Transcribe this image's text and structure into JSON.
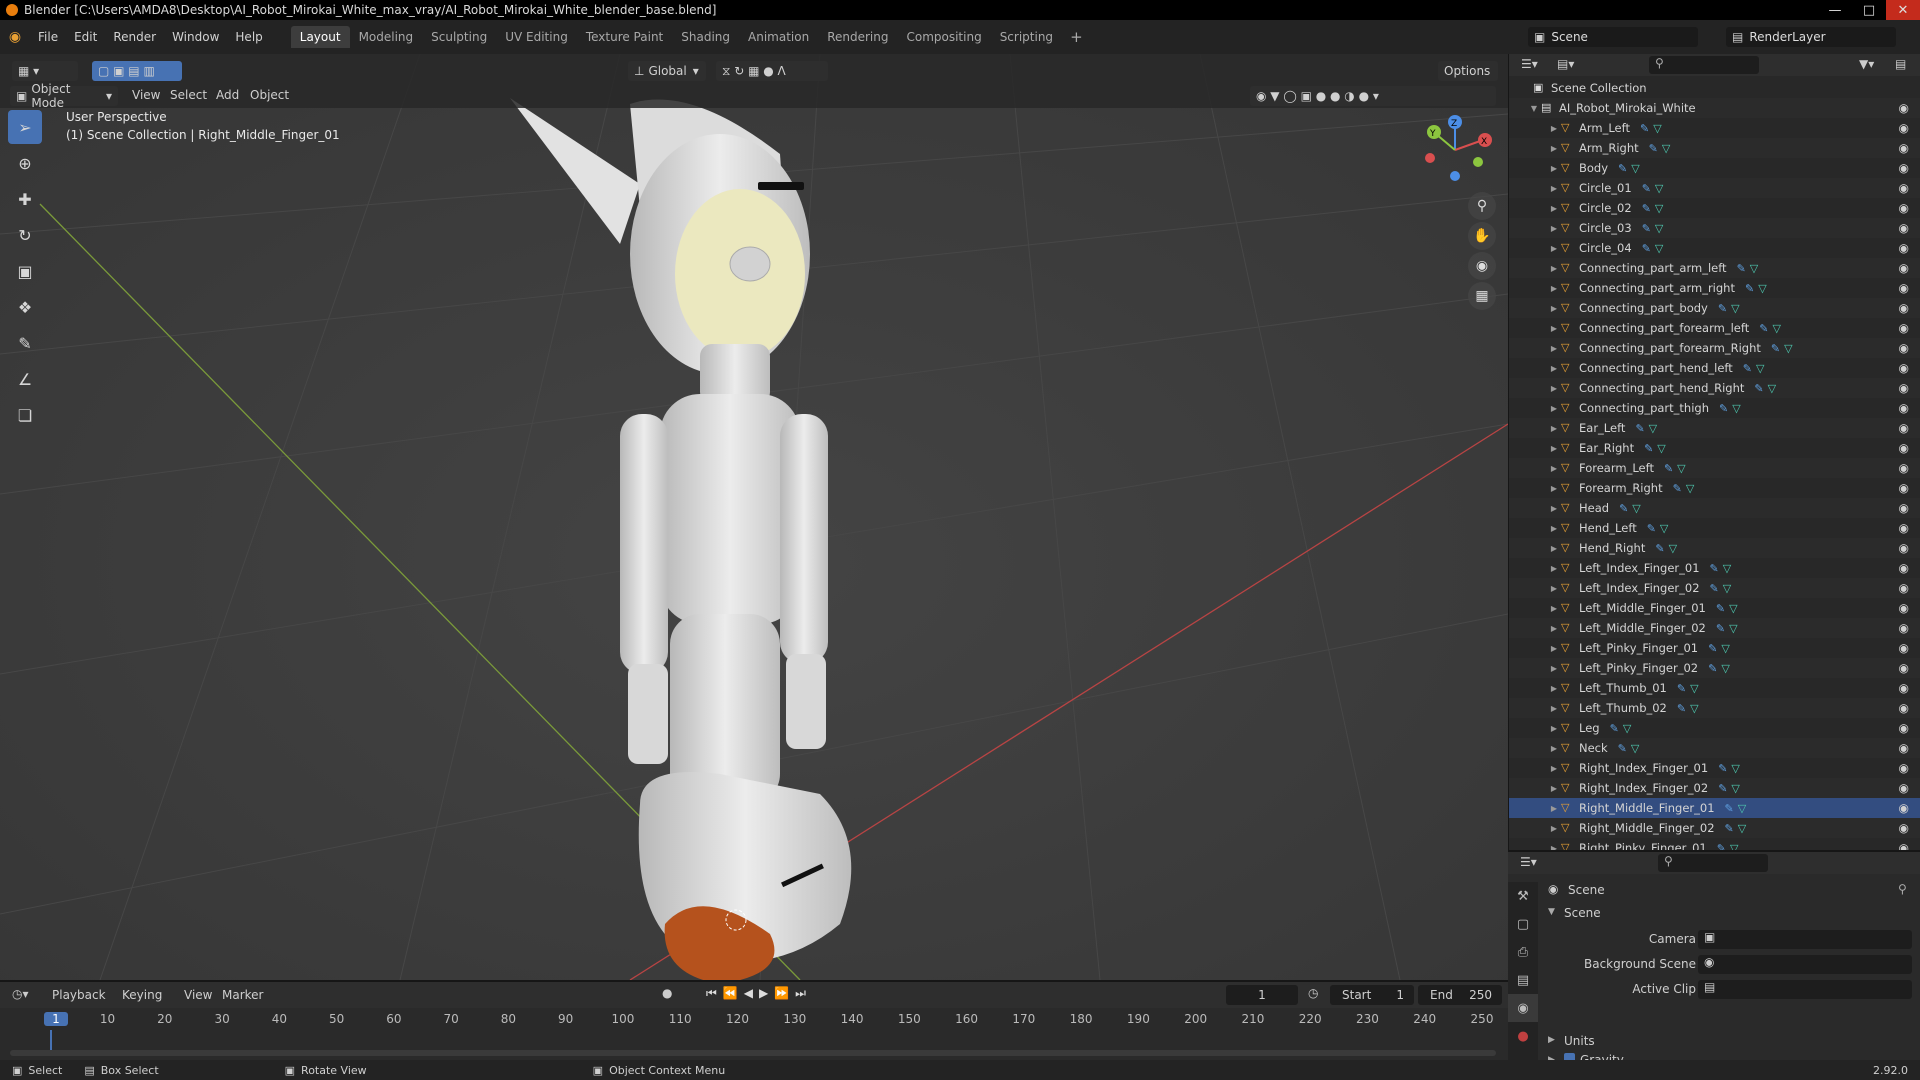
{
  "window": {
    "title": "Blender [C:\\Users\\AMDA8\\Desktop\\AI_Robot_Mirokai_White_max_vray/AI_Robot_Mirokai_White_blender_base.blend]",
    "min_icon": "minimize-icon",
    "max_icon": "maximize-icon",
    "close_icon": "close-icon"
  },
  "menus": [
    "File",
    "Edit",
    "Render",
    "Window",
    "Help"
  ],
  "workspaces": [
    "Layout",
    "Modeling",
    "Sculpting",
    "UV Editing",
    "Texture Paint",
    "Shading",
    "Animation",
    "Rendering",
    "Compositing",
    "Scripting"
  ],
  "active_workspace": "Layout",
  "scene_name": "Scene",
  "render_layer": "RenderLayer",
  "viewport": {
    "mode": "Object Mode",
    "menu": [
      "View",
      "Select",
      "Add",
      "Object"
    ],
    "orientation": "Global",
    "options": "Options",
    "perspective": "User Perspective",
    "collection_info": "(1) Scene Collection | Right_Middle_Finger_01",
    "gizmo": {
      "x": "X",
      "y": "Y",
      "z": "Z"
    }
  },
  "outliner": {
    "root": "Scene Collection",
    "collection": "AI_Robot_Mirokai_White",
    "selected": "Right_Middle_Finger_01",
    "items": [
      "Arm_Left",
      "Arm_Right",
      "Body",
      "Circle_01",
      "Circle_02",
      "Circle_03",
      "Circle_04",
      "Connecting_part_arm_left",
      "Connecting_part_arm_right",
      "Connecting_part_body",
      "Connecting_part_forearm_left",
      "Connecting_part_forearm_Right",
      "Connecting_part_hend_left",
      "Connecting_part_hend_Right",
      "Connecting_part_thigh",
      "Ear_Left",
      "Ear_Right",
      "Forearm_Left",
      "Forearm_Right",
      "Head",
      "Hend_Left",
      "Hend_Right",
      "Left_Index_Finger_01",
      "Left_Index_Finger_02",
      "Left_Middle_Finger_01",
      "Left_Middle_Finger_02",
      "Left_Pinky_Finger_01",
      "Left_Pinky_Finger_02",
      "Left_Thumb_01",
      "Left_Thumb_02",
      "Leg",
      "Neck",
      "Right_Index_Finger_01",
      "Right_Index_Finger_02",
      "Right_Middle_Finger_01",
      "Right_Middle_Finger_02",
      "Right_Pinky_Finger_01"
    ]
  },
  "properties": {
    "header": "Scene",
    "section": "Scene",
    "fields": [
      "Camera",
      "Background Scene",
      "Active Clip"
    ],
    "units": "Units",
    "gravity": "Gravity"
  },
  "timeline": {
    "menu": [
      "Playback",
      "Keying",
      "View",
      "Marker"
    ],
    "current_frame": "1",
    "start_label": "Start",
    "start": "1",
    "end_label": "End",
    "end": "250",
    "ticks": [
      "1",
      "10",
      "20",
      "30",
      "40",
      "50",
      "60",
      "70",
      "80",
      "90",
      "100",
      "110",
      "120",
      "130",
      "140",
      "150",
      "160",
      "170",
      "180",
      "190",
      "200",
      "210",
      "220",
      "230",
      "240",
      "250"
    ]
  },
  "status": {
    "select": "Select",
    "box_select": "Box Select",
    "rotate_view": "Rotate View",
    "context_menu": "Object Context Menu",
    "version": "2.92.0"
  },
  "colors": {
    "accent": "#4772b3",
    "object_icon": "#e8a034",
    "axis_x": "#d94f4f",
    "axis_y": "#8cc63f",
    "axis_z": "#4c8ee6"
  }
}
